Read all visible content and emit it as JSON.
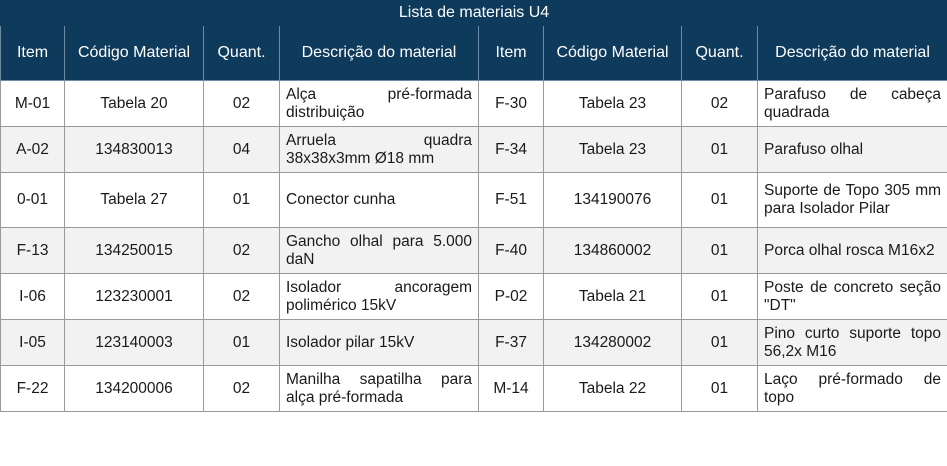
{
  "table": {
    "title": "Lista de materiais U4",
    "headers": [
      "Item",
      "Código Material",
      "Quant.",
      "Descrição do material",
      "Item",
      "Código Material",
      "Quant.",
      "Descrição do material"
    ],
    "rows": [
      {
        "item_l": "M-01",
        "code_l": "Tabela 20",
        "qty_l": "02",
        "desc_l": "Alça pré-formada distribuição",
        "item_r": "F-30",
        "code_r": "Tabela 23",
        "qty_r": "02",
        "desc_r": "Parafuso de cabeça quadrada"
      },
      {
        "item_l": "A-02",
        "code_l": "134830013",
        "qty_l": "04",
        "desc_l": "Arruela quadra 38x38x3mm Ø18 mm",
        "item_r": "F-34",
        "code_r": "Tabela 23",
        "qty_r": "01",
        "desc_r": "Parafuso olhal"
      },
      {
        "item_l": "0-01",
        "code_l": "Tabela 27",
        "qty_l": "01",
        "desc_l": "Conector cunha",
        "item_r": "F-51",
        "code_r": "134190076",
        "qty_r": "01",
        "desc_r": "Suporte de Topo 305 mm para Isolador Pilar"
      },
      {
        "item_l": "F-13",
        "code_l": "134250015",
        "qty_l": "02",
        "desc_l": "Gancho olhal para 5.000 daN",
        "item_r": "F-40",
        "code_r": "134860002",
        "qty_r": "01",
        "desc_r": "Porca olhal rosca M16x2"
      },
      {
        "item_l": "I-06",
        "code_l": "123230001",
        "qty_l": "02",
        "desc_l": "Isolador ancoragem polimérico 15kV",
        "item_r": "P-02",
        "code_r": "Tabela 21",
        "qty_r": "01",
        "desc_r": "Poste de concreto seção \"DT\""
      },
      {
        "item_l": "I-05",
        "code_l": "123140003",
        "qty_l": "01",
        "desc_l": "Isolador pilar 15kV",
        "item_r": "F-37",
        "code_r": "134280002",
        "qty_r": "01",
        "desc_r": "Pino curto suporte topo 56,2x M16"
      },
      {
        "item_l": "F-22",
        "code_l": "134200006",
        "qty_l": "02",
        "desc_l": "Manilha sapatilha para alça pré-formada",
        "item_r": "M-14",
        "code_r": "Tabela 22",
        "qty_r": "01",
        "desc_r": "Laço pré-formado de topo"
      }
    ]
  },
  "colors": {
    "header_bg": "#0e3a5c",
    "header_text": "#ffffff",
    "grid": "#9a9a9a"
  }
}
